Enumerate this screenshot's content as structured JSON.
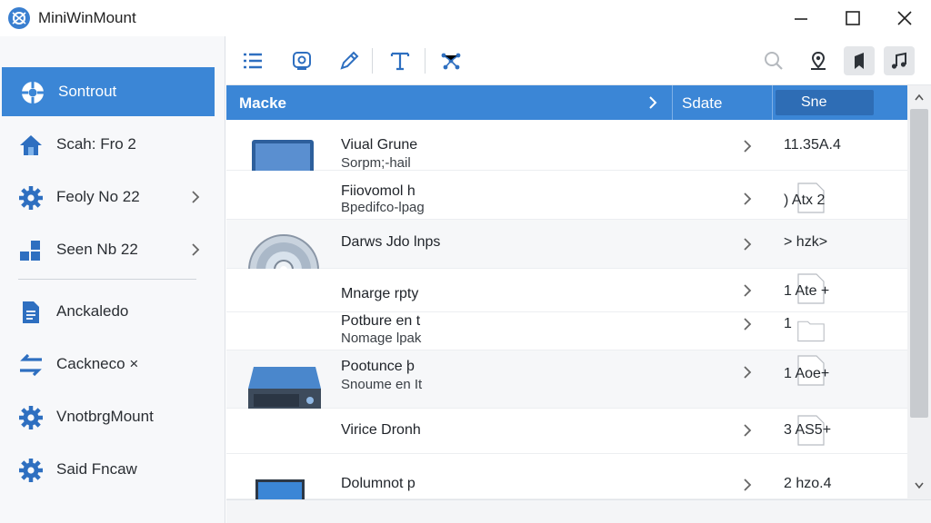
{
  "window": {
    "title": "MiniWinMount",
    "controls": [
      "minimize-icon",
      "maximize-icon",
      "close-icon"
    ]
  },
  "sidebar": {
    "items": [
      {
        "label": "Sontrout",
        "icon": "lifebuoy-icon",
        "active": true
      },
      {
        "label": "Scah: Fro 2",
        "icon": "home-icon"
      },
      {
        "label": "Feoly No 22",
        "icon": "gear-icon",
        "chevron": true
      },
      {
        "label": "Seen Nb 22",
        "icon": "grid-icon",
        "chevron": true
      },
      {
        "label": "Anckaledo",
        "icon": "document-icon"
      },
      {
        "label": "Cackneco ×",
        "icon": "swap-arrows-icon"
      },
      {
        "label": "VnotbrgMount",
        "icon": "gear-icon"
      },
      {
        "label": "Said Fncaw",
        "icon": "gear-icon"
      }
    ]
  },
  "toolbar": {
    "buttons": [
      "list-icon",
      "disk-refresh-icon",
      "pen-icon",
      "text-tool-icon",
      "network-icon",
      "search-icon",
      "location-pin-icon",
      "bookmark-icon",
      "music-icon"
    ]
  },
  "table": {
    "columns": {
      "name": "Macke",
      "state": "Sdate",
      "size": "Sne"
    },
    "rows": [
      {
        "name": "Viual Grune",
        "sub": "Sorpm;-hail",
        "size": "11.35A.4"
      },
      {
        "name": "Fiiovomol h",
        "sub": "Bpedifco-lpag",
        "size": ") Atx 2"
      },
      {
        "name": "Darws Jdo lnps",
        "sub": "",
        "size": "> hzk>"
      },
      {
        "name": "Mnarge rpty",
        "sub": "",
        "size": "1 Ate +"
      },
      {
        "name": "Potbure en t",
        "sub": "Nomage lpak",
        "size": "1"
      },
      {
        "name": "Pootunce þ",
        "sub": "Snoume en It",
        "size": "1 Aoe+"
      },
      {
        "name": "Virice Dronh",
        "sub": "",
        "size": "3 AS5+"
      },
      {
        "name": "Dolumnot p",
        "sub": "",
        "size": "2 hzo.4"
      }
    ]
  },
  "colors": {
    "accent": "#3b86d6",
    "header_dark": "#2e6db5",
    "icon_blue": "#2e6fc0"
  }
}
